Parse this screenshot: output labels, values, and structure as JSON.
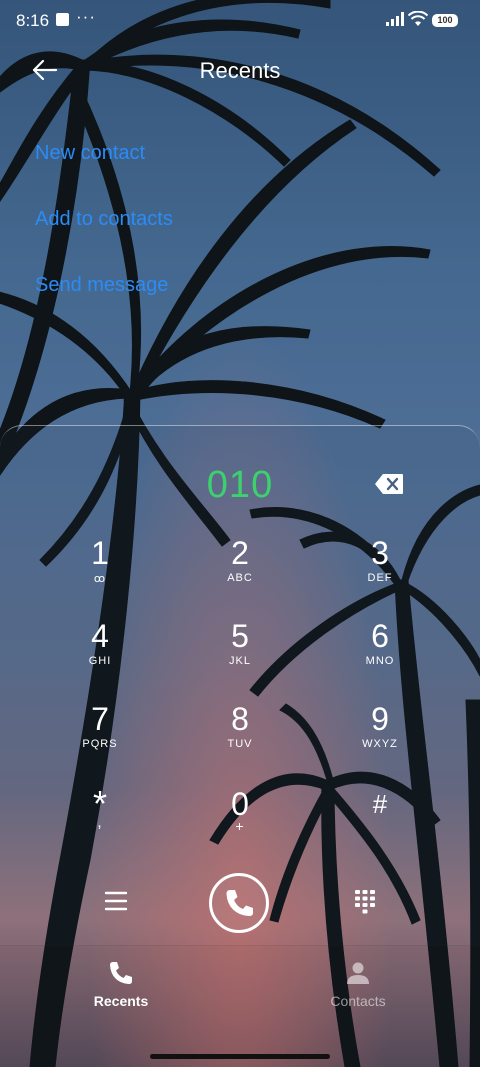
{
  "status_bar": {
    "time": "8:16",
    "battery": "100"
  },
  "header": {
    "title": "Recents"
  },
  "actions": [
    {
      "id": "new_contact",
      "label": "New contact"
    },
    {
      "id": "add_to_contacts",
      "label": "Add to contacts"
    },
    {
      "id": "send_message",
      "label": "Send message"
    }
  ],
  "dialer": {
    "number": "010",
    "keys": [
      {
        "digit": "1",
        "letters": "ꝏ"
      },
      {
        "digit": "2",
        "letters": "ABC"
      },
      {
        "digit": "3",
        "letters": "DEF"
      },
      {
        "digit": "4",
        "letters": "GHI"
      },
      {
        "digit": "5",
        "letters": "JKL"
      },
      {
        "digit": "6",
        "letters": "MNO"
      },
      {
        "digit": "7",
        "letters": "PQRS"
      },
      {
        "digit": "8",
        "letters": "TUV"
      },
      {
        "digit": "9",
        "letters": "WXYZ"
      },
      {
        "digit": "*",
        "letters": ","
      },
      {
        "digit": "0",
        "letters": "+"
      },
      {
        "digit": "#",
        "letters": ""
      }
    ]
  },
  "bottom_nav": [
    {
      "label": "Recents",
      "icon": "phone-icon",
      "active": true
    },
    {
      "label": "Contacts",
      "icon": "person-icon",
      "active": false
    }
  ],
  "colors": {
    "accent": "#2b8cf5",
    "number": "#3dd16e"
  }
}
